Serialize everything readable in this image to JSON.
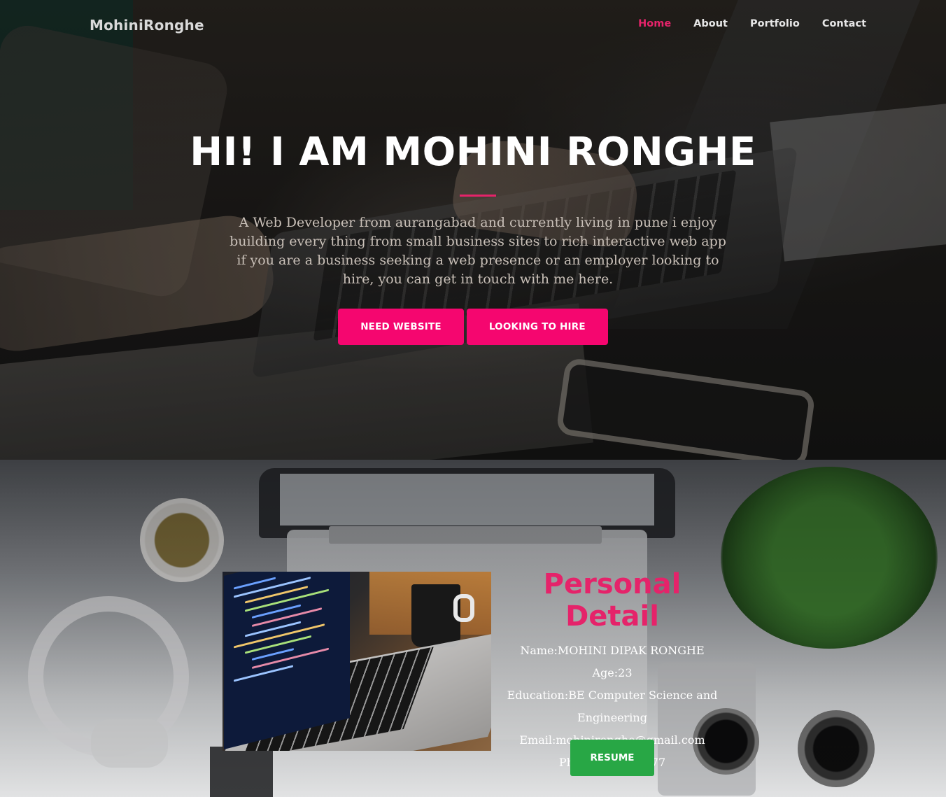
{
  "nav": {
    "brand": "MohiniRonghe",
    "links": [
      {
        "label": "Home",
        "active": true
      },
      {
        "label": "About",
        "active": false
      },
      {
        "label": "Portfolio",
        "active": false
      },
      {
        "label": "Contact",
        "active": false
      }
    ]
  },
  "hero": {
    "title": "HI! I AM MOHINI RONGHE",
    "description": "A Web Developer from aurangabad and currently living in pune i enjoy building every thing from small business sites to rich interactive web app if you are a business seeking a web presence or an employer looking to hire, you can get in touch with me here.",
    "buttons": {
      "need_website": "NEED WEBSITE",
      "looking_to_hire": "LOOKING TO HIRE"
    }
  },
  "personal": {
    "title": "Personal Detail",
    "name": "Name:MOHINI DIPAK RONGHE",
    "age": "Age:23",
    "education": "Education:BE Computer Science and Engineering",
    "email": "Email:mohinironghe@gmail.com",
    "phone": "Phone9637633177",
    "resume_label": "RESUME"
  },
  "colors": {
    "accent_pink": "#f5066f",
    "nav_active": "#e5236a",
    "resume_green": "#28a745"
  }
}
